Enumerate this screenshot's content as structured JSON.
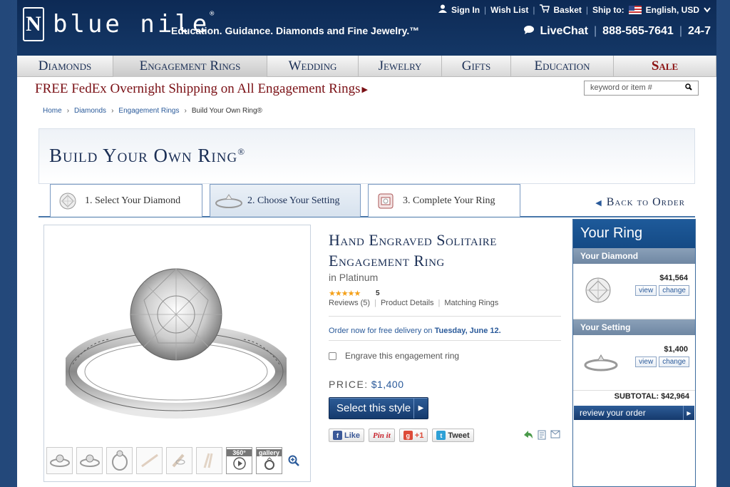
{
  "header": {
    "logo_text": "blue nile",
    "logo_mark": "N",
    "logo_reg": "®",
    "tagline": "Education. Guidance. Diamonds and Fine Jewelry.™",
    "utility": {
      "sign_in": "Sign In",
      "wish_list": "Wish List",
      "basket": "Basket",
      "ship_to": "Ship to:",
      "locale": "English, USD"
    },
    "contact": {
      "livechat": "LiveChat",
      "phone": "888-565-7641",
      "hours": "24-7"
    }
  },
  "nav": {
    "items": [
      {
        "label": "Diamonds"
      },
      {
        "label": "Engagement Rings"
      },
      {
        "label": "Wedding"
      },
      {
        "label": "Jewelry"
      },
      {
        "label": "Gifts"
      },
      {
        "label": "Education"
      },
      {
        "label": "Sale"
      }
    ]
  },
  "promo": {
    "text": "FREE FedEx Overnight Shipping on All Engagement Rings"
  },
  "search": {
    "placeholder": "keyword or item #"
  },
  "breadcrumb": [
    "Home",
    "Diamonds",
    "Engagement Rings",
    "Build Your Own Ring®"
  ],
  "builder": {
    "title": "Build Your Own Ring",
    "title_reg": "®",
    "steps": [
      {
        "label": "1. Select Your Diamond",
        "icon": "diamond-icon"
      },
      {
        "label": "2. Choose Your Setting",
        "icon": "ring-setting-icon"
      },
      {
        "label": "3. Complete Your Ring",
        "icon": "ring-box-icon"
      }
    ],
    "back_label": "Back to Order"
  },
  "product": {
    "title_line1": "Hand Engraved Solitaire",
    "title_line2": "Engagement Ring",
    "subtitle": "in Platinum",
    "stars": "★★★★★",
    "rating": "5",
    "rating_out_of": 5,
    "reviews_link": "Reviews (5)",
    "details_link": "Product Details",
    "matching_link": "Matching Rings",
    "delivery_text": "Order now for free delivery on",
    "delivery_date": "Tuesday, June 12.",
    "engrave_label": "Engrave this engagement ring",
    "price_label": "PRICE:",
    "price": "$1,400",
    "select_button": "Select this style",
    "thumb_360": "360°",
    "thumb_gallery": "gallery"
  },
  "social": {
    "like": "Like",
    "pin": "Pin it",
    "plus": "+1",
    "tweet": "Tweet"
  },
  "your_ring": {
    "title": "Your Ring",
    "diamond_label": "Your Diamond",
    "diamond_price": "$41,564",
    "setting_label": "Your Setting",
    "setting_price": "$1,400",
    "view": "view",
    "change": "change",
    "subtotal_label": "SUBTOTAL:",
    "subtotal": "$42,964",
    "review_button": "review your order"
  },
  "colors": {
    "navy": "#1b2f55",
    "header_bg": "#0d2a55",
    "link_blue": "#2a5a9a",
    "promo_red": "#7a1015",
    "sale_red": "#8b1111",
    "star_gold": "#f4a018"
  }
}
